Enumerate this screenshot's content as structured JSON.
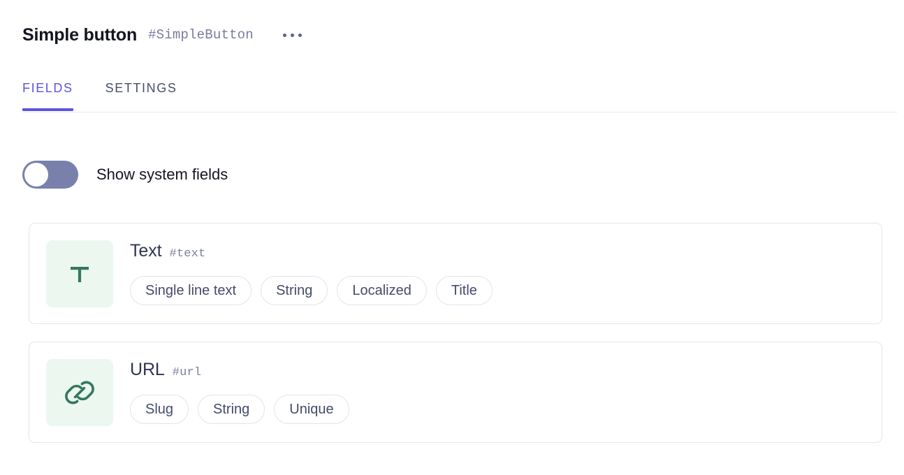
{
  "header": {
    "title": "Simple button",
    "slug": "#SimpleButton",
    "menu_icon": "kebab-menu-icon"
  },
  "tabs": [
    {
      "label": "FIELDS",
      "active": true
    },
    {
      "label": "SETTINGS",
      "active": false
    }
  ],
  "toggle": {
    "label": "Show system fields",
    "state": "off",
    "track_color": "#7880AB"
  },
  "colors": {
    "accent": "#5B55DD",
    "icon_green": "#35775E",
    "icon_bg": "#EBF7EF",
    "card_border": "#E3E5F0",
    "pill_border": "#E2E4EE",
    "pill_text": "#434B6B",
    "slug_text": "#7A809E"
  },
  "fields": [
    {
      "name": "Text",
      "slug": "#text",
      "icon": "text-t-icon",
      "tags": [
        "Single line text",
        "String",
        "Localized",
        "Title"
      ]
    },
    {
      "name": "URL",
      "slug": "#url",
      "icon": "link-icon",
      "tags": [
        "Slug",
        "String",
        "Unique"
      ]
    }
  ]
}
